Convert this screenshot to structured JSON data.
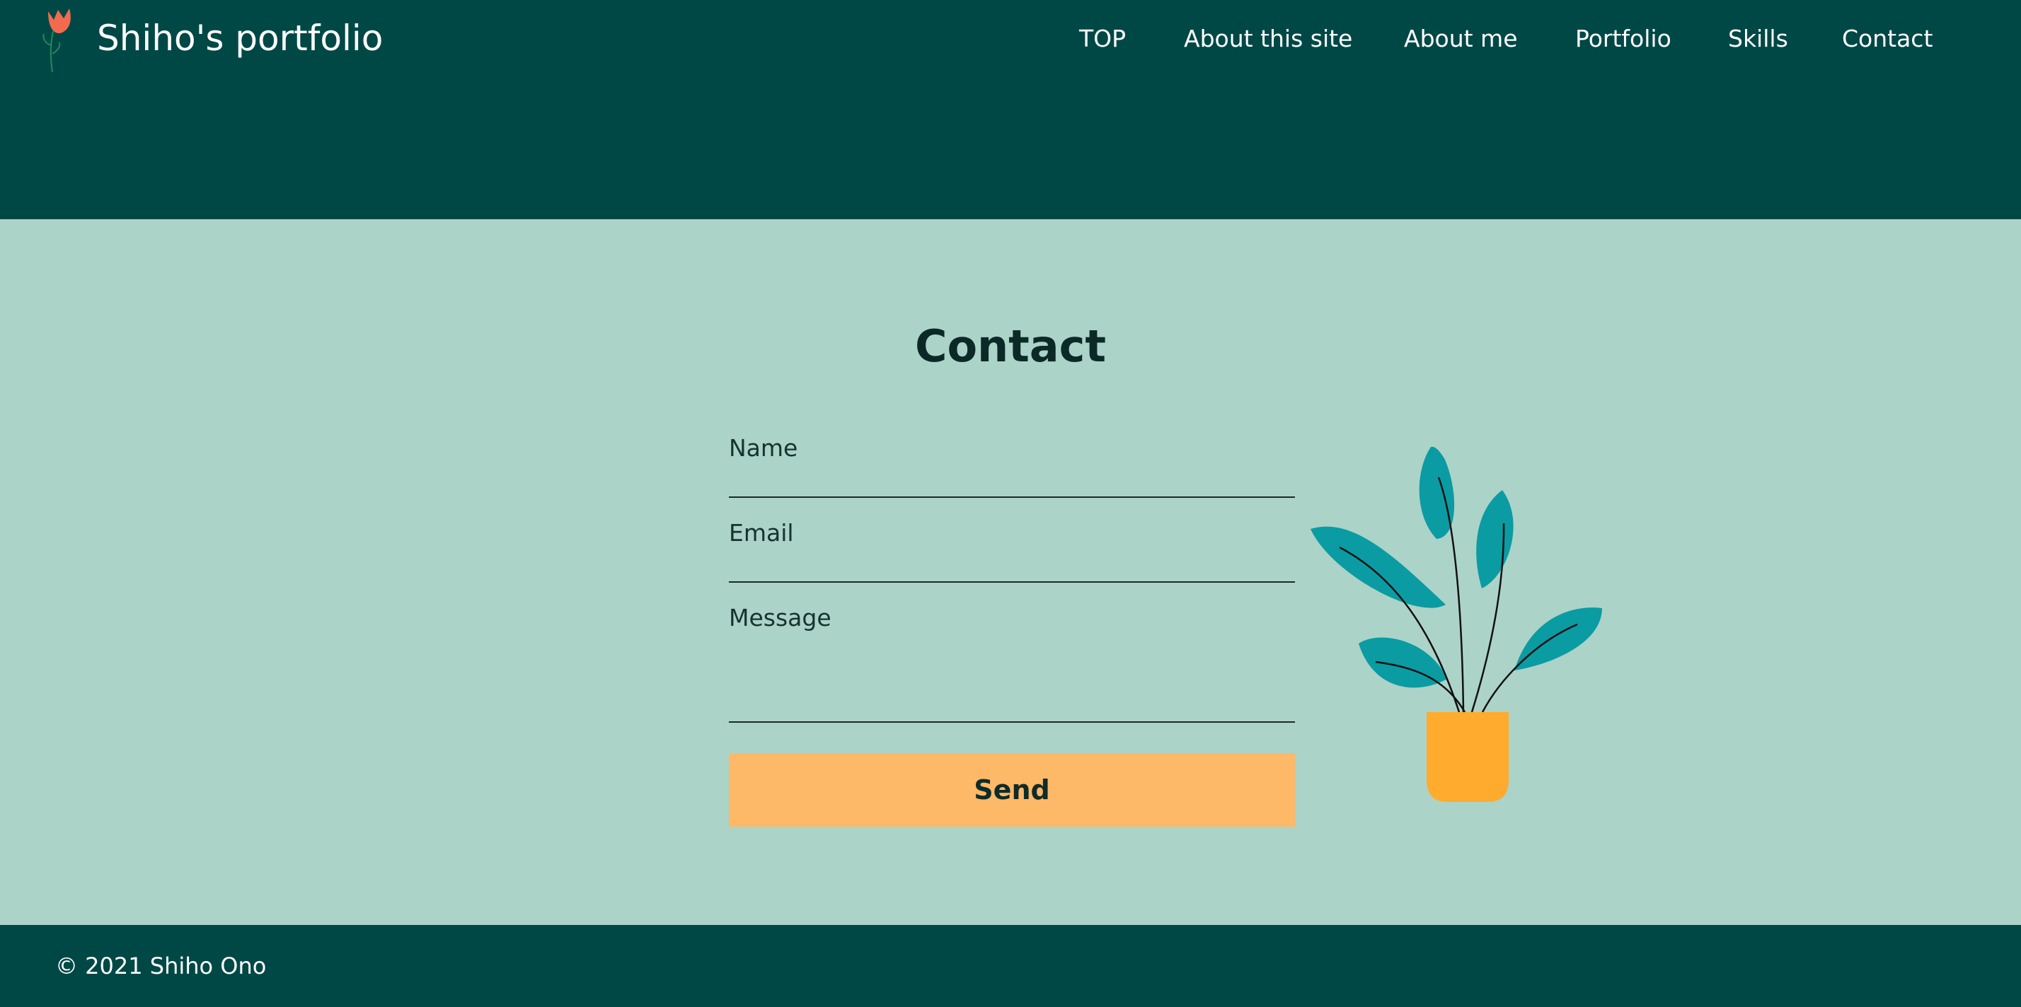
{
  "header": {
    "site_title": "Shiho's portfolio",
    "logo_icon": "tulip-icon",
    "nav": [
      {
        "label": "TOP"
      },
      {
        "label": "About this site"
      },
      {
        "label": "About me"
      },
      {
        "label": "Portfolio"
      },
      {
        "label": "Skills"
      },
      {
        "label": "Contact"
      }
    ]
  },
  "contact": {
    "title": "Contact",
    "fields": {
      "name_placeholder": "Name",
      "email_placeholder": "Email",
      "message_placeholder": "Message"
    },
    "send_label": "Send",
    "illustration": "potted-plant-icon"
  },
  "footer": {
    "copyright": "© 2021 Shiho Ono"
  },
  "colors": {
    "header_bg": "#004846",
    "main_bg": "#acd3c8",
    "button_bg": "#fdb868",
    "leaf": "#0b9ba3",
    "pot": "#ffab2e",
    "logo_flower": "#f26b4f"
  }
}
